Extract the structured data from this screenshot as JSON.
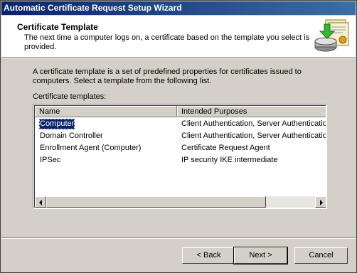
{
  "window": {
    "title": "Automatic Certificate Request Setup Wizard"
  },
  "header": {
    "title": "Certificate Template",
    "subtitle": "The next time a computer logs on, a certificate based on the template you select is provided."
  },
  "body": {
    "description": "A certificate template is a set of predefined properties for certificates issued to computers. Select a template from the following list.",
    "list_label": "Certificate templates:"
  },
  "list": {
    "columns": [
      "Name",
      "Intended Purposes"
    ],
    "rows": [
      {
        "name": "Computer",
        "purposes": "Client Authentication, Server Authentication",
        "selected": true
      },
      {
        "name": "Domain Controller",
        "purposes": "Client Authentication, Server Authentication"
      },
      {
        "name": "Enrollment Agent (Computer)",
        "purposes": "Certificate Request Agent"
      },
      {
        "name": "IPSec",
        "purposes": "IP security IKE intermediate"
      }
    ]
  },
  "buttons": {
    "back": "< Back",
    "next": "Next >",
    "cancel": "Cancel"
  },
  "colors": {
    "titlebar_start": "#0a246a",
    "titlebar_end": "#3a6ea5",
    "selection": "#0a246a",
    "face": "#d4d0c8"
  }
}
